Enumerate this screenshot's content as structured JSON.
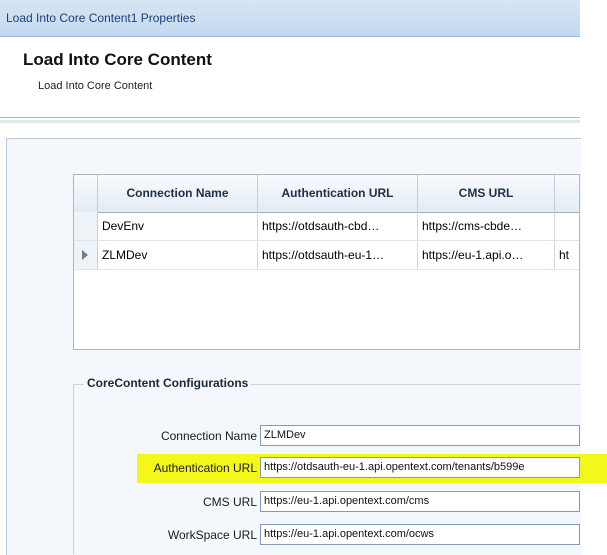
{
  "window": {
    "title": "Load Into Core Content1 Properties"
  },
  "header": {
    "title": "Load Into Core Content",
    "subtitle": "Load Into Core Content"
  },
  "grid": {
    "columns": [
      "Connection Name",
      "Authentication URL",
      "CMS URL"
    ],
    "rows": [
      {
        "name": "DevEnv",
        "auth_url": "https://otdsauth-cbd…",
        "cms_url": "https://cms-cbde…",
        "extra": ""
      },
      {
        "name": "ZLMDev",
        "auth_url": "https://otdsauth-eu-1…",
        "cms_url": "https://eu-1.api.o…",
        "extra": "ht"
      }
    ],
    "selected_row_index": 1
  },
  "config": {
    "legend": "CoreContent Configurations",
    "fields": [
      {
        "label": "Connection Name",
        "value": "ZLMDev"
      },
      {
        "label": "Authentication URL",
        "value": "https://otdsauth-eu-1.api.opentext.com/tenants/b599e",
        "highlighted": true
      },
      {
        "label": "CMS URL",
        "value": "https://eu-1.api.opentext.com/cms"
      },
      {
        "label": "WorkSpace URL",
        "value": "https://eu-1.api.opentext.com/ocws"
      }
    ]
  },
  "colors": {
    "highlight": "#f4f81a",
    "title_text": "#1a3f7a"
  }
}
